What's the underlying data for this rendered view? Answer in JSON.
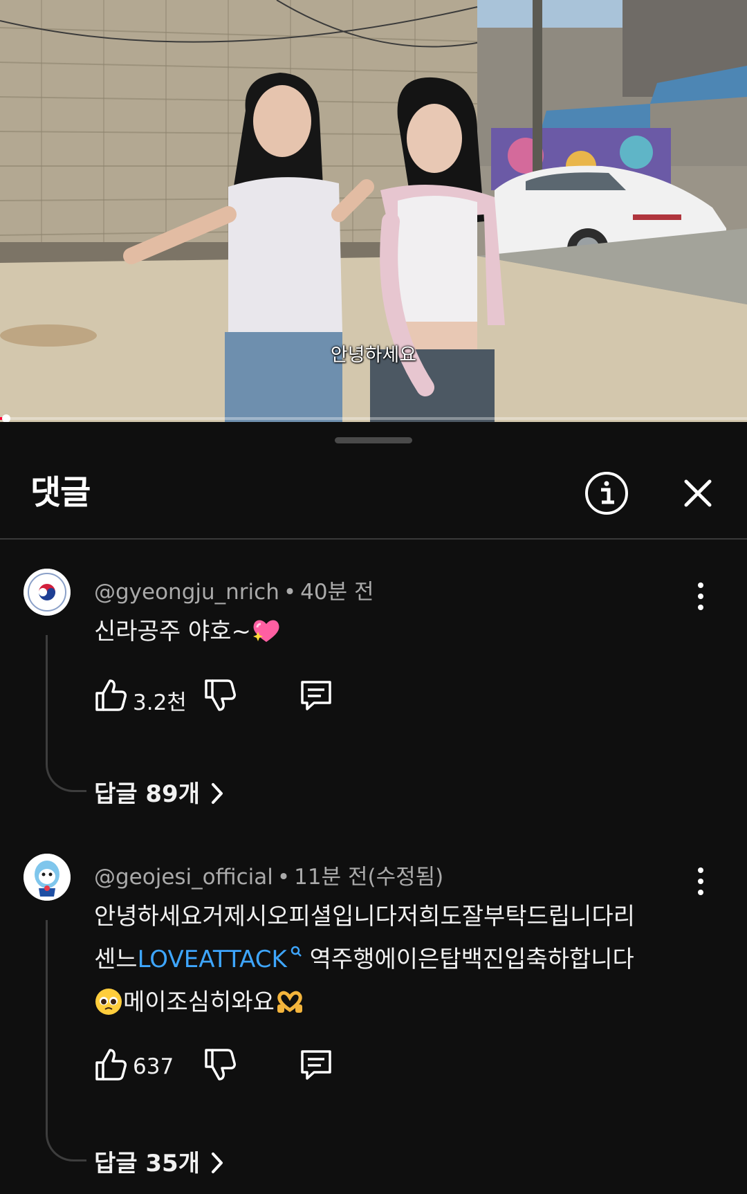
{
  "video": {
    "caption": "안녕하세요",
    "progress": 0.008
  },
  "comments_panel": {
    "title": "댓글",
    "info_icon": "info-circle-icon",
    "close_icon": "close-icon"
  },
  "comments": [
    {
      "handle": "@gyeongju_nrich",
      "separator": "•",
      "time": "40분 전",
      "text_lines": [
        {
          "prefix": "신라공주 야호~",
          "link": "",
          "suffix": ""
        }
      ],
      "trailing_emoji": "sparkling-heart",
      "likes": "3.2천",
      "replies_label": "답글 89개",
      "avatar": "government-seal-avatar"
    },
    {
      "handle": "@geojesi_official",
      "separator": "•",
      "time": "11분 전(수정됨)",
      "text_lines": [
        {
          "prefix": "안녕하세요거제시오피셜입니다저희도잘부탁드립니다리",
          "link": "",
          "suffix": ""
        },
        {
          "prefix": "센느",
          "link": "LOVEATTACK",
          "suffix": " 역주행에이은탑백진입축하합니다"
        },
        {
          "prefix": "메이조심히와요",
          "link": "",
          "suffix": ""
        }
      ],
      "leading_emoji": "pleading-face",
      "trailing_emoji": "heart-hands",
      "likes": "637",
      "replies_label": "답글 35개",
      "avatar": "mascot-avatar"
    }
  ],
  "colors": {
    "background": "#0f0f0f",
    "link": "#3ea6ff",
    "secondary_text": "#aaaaaa",
    "progress": "#ff0033"
  }
}
